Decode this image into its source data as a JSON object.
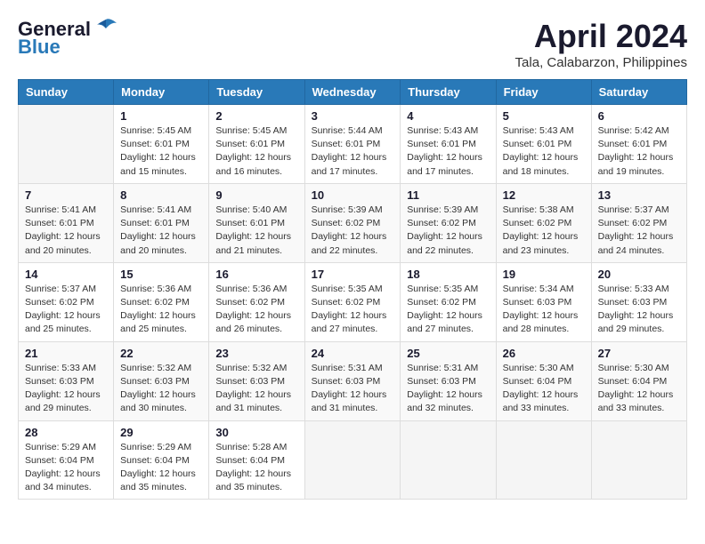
{
  "header": {
    "logo_general": "General",
    "logo_blue": "Blue",
    "month_title": "April 2024",
    "location": "Tala, Calabarzon, Philippines"
  },
  "weekdays": [
    "Sunday",
    "Monday",
    "Tuesday",
    "Wednesday",
    "Thursday",
    "Friday",
    "Saturday"
  ],
  "weeks": [
    [
      {
        "day": "",
        "info": ""
      },
      {
        "day": "1",
        "info": "Sunrise: 5:45 AM\nSunset: 6:01 PM\nDaylight: 12 hours\nand 15 minutes."
      },
      {
        "day": "2",
        "info": "Sunrise: 5:45 AM\nSunset: 6:01 PM\nDaylight: 12 hours\nand 16 minutes."
      },
      {
        "day": "3",
        "info": "Sunrise: 5:44 AM\nSunset: 6:01 PM\nDaylight: 12 hours\nand 17 minutes."
      },
      {
        "day": "4",
        "info": "Sunrise: 5:43 AM\nSunset: 6:01 PM\nDaylight: 12 hours\nand 17 minutes."
      },
      {
        "day": "5",
        "info": "Sunrise: 5:43 AM\nSunset: 6:01 PM\nDaylight: 12 hours\nand 18 minutes."
      },
      {
        "day": "6",
        "info": "Sunrise: 5:42 AM\nSunset: 6:01 PM\nDaylight: 12 hours\nand 19 minutes."
      }
    ],
    [
      {
        "day": "7",
        "info": "Sunrise: 5:41 AM\nSunset: 6:01 PM\nDaylight: 12 hours\nand 20 minutes."
      },
      {
        "day": "8",
        "info": "Sunrise: 5:41 AM\nSunset: 6:01 PM\nDaylight: 12 hours\nand 20 minutes."
      },
      {
        "day": "9",
        "info": "Sunrise: 5:40 AM\nSunset: 6:01 PM\nDaylight: 12 hours\nand 21 minutes."
      },
      {
        "day": "10",
        "info": "Sunrise: 5:39 AM\nSunset: 6:02 PM\nDaylight: 12 hours\nand 22 minutes."
      },
      {
        "day": "11",
        "info": "Sunrise: 5:39 AM\nSunset: 6:02 PM\nDaylight: 12 hours\nand 22 minutes."
      },
      {
        "day": "12",
        "info": "Sunrise: 5:38 AM\nSunset: 6:02 PM\nDaylight: 12 hours\nand 23 minutes."
      },
      {
        "day": "13",
        "info": "Sunrise: 5:37 AM\nSunset: 6:02 PM\nDaylight: 12 hours\nand 24 minutes."
      }
    ],
    [
      {
        "day": "14",
        "info": "Sunrise: 5:37 AM\nSunset: 6:02 PM\nDaylight: 12 hours\nand 25 minutes."
      },
      {
        "day": "15",
        "info": "Sunrise: 5:36 AM\nSunset: 6:02 PM\nDaylight: 12 hours\nand 25 minutes."
      },
      {
        "day": "16",
        "info": "Sunrise: 5:36 AM\nSunset: 6:02 PM\nDaylight: 12 hours\nand 26 minutes."
      },
      {
        "day": "17",
        "info": "Sunrise: 5:35 AM\nSunset: 6:02 PM\nDaylight: 12 hours\nand 27 minutes."
      },
      {
        "day": "18",
        "info": "Sunrise: 5:35 AM\nSunset: 6:02 PM\nDaylight: 12 hours\nand 27 minutes."
      },
      {
        "day": "19",
        "info": "Sunrise: 5:34 AM\nSunset: 6:03 PM\nDaylight: 12 hours\nand 28 minutes."
      },
      {
        "day": "20",
        "info": "Sunrise: 5:33 AM\nSunset: 6:03 PM\nDaylight: 12 hours\nand 29 minutes."
      }
    ],
    [
      {
        "day": "21",
        "info": "Sunrise: 5:33 AM\nSunset: 6:03 PM\nDaylight: 12 hours\nand 29 minutes."
      },
      {
        "day": "22",
        "info": "Sunrise: 5:32 AM\nSunset: 6:03 PM\nDaylight: 12 hours\nand 30 minutes."
      },
      {
        "day": "23",
        "info": "Sunrise: 5:32 AM\nSunset: 6:03 PM\nDaylight: 12 hours\nand 31 minutes."
      },
      {
        "day": "24",
        "info": "Sunrise: 5:31 AM\nSunset: 6:03 PM\nDaylight: 12 hours\nand 31 minutes."
      },
      {
        "day": "25",
        "info": "Sunrise: 5:31 AM\nSunset: 6:03 PM\nDaylight: 12 hours\nand 32 minutes."
      },
      {
        "day": "26",
        "info": "Sunrise: 5:30 AM\nSunset: 6:04 PM\nDaylight: 12 hours\nand 33 minutes."
      },
      {
        "day": "27",
        "info": "Sunrise: 5:30 AM\nSunset: 6:04 PM\nDaylight: 12 hours\nand 33 minutes."
      }
    ],
    [
      {
        "day": "28",
        "info": "Sunrise: 5:29 AM\nSunset: 6:04 PM\nDaylight: 12 hours\nand 34 minutes."
      },
      {
        "day": "29",
        "info": "Sunrise: 5:29 AM\nSunset: 6:04 PM\nDaylight: 12 hours\nand 35 minutes."
      },
      {
        "day": "30",
        "info": "Sunrise: 5:28 AM\nSunset: 6:04 PM\nDaylight: 12 hours\nand 35 minutes."
      },
      {
        "day": "",
        "info": ""
      },
      {
        "day": "",
        "info": ""
      },
      {
        "day": "",
        "info": ""
      },
      {
        "day": "",
        "info": ""
      }
    ]
  ]
}
